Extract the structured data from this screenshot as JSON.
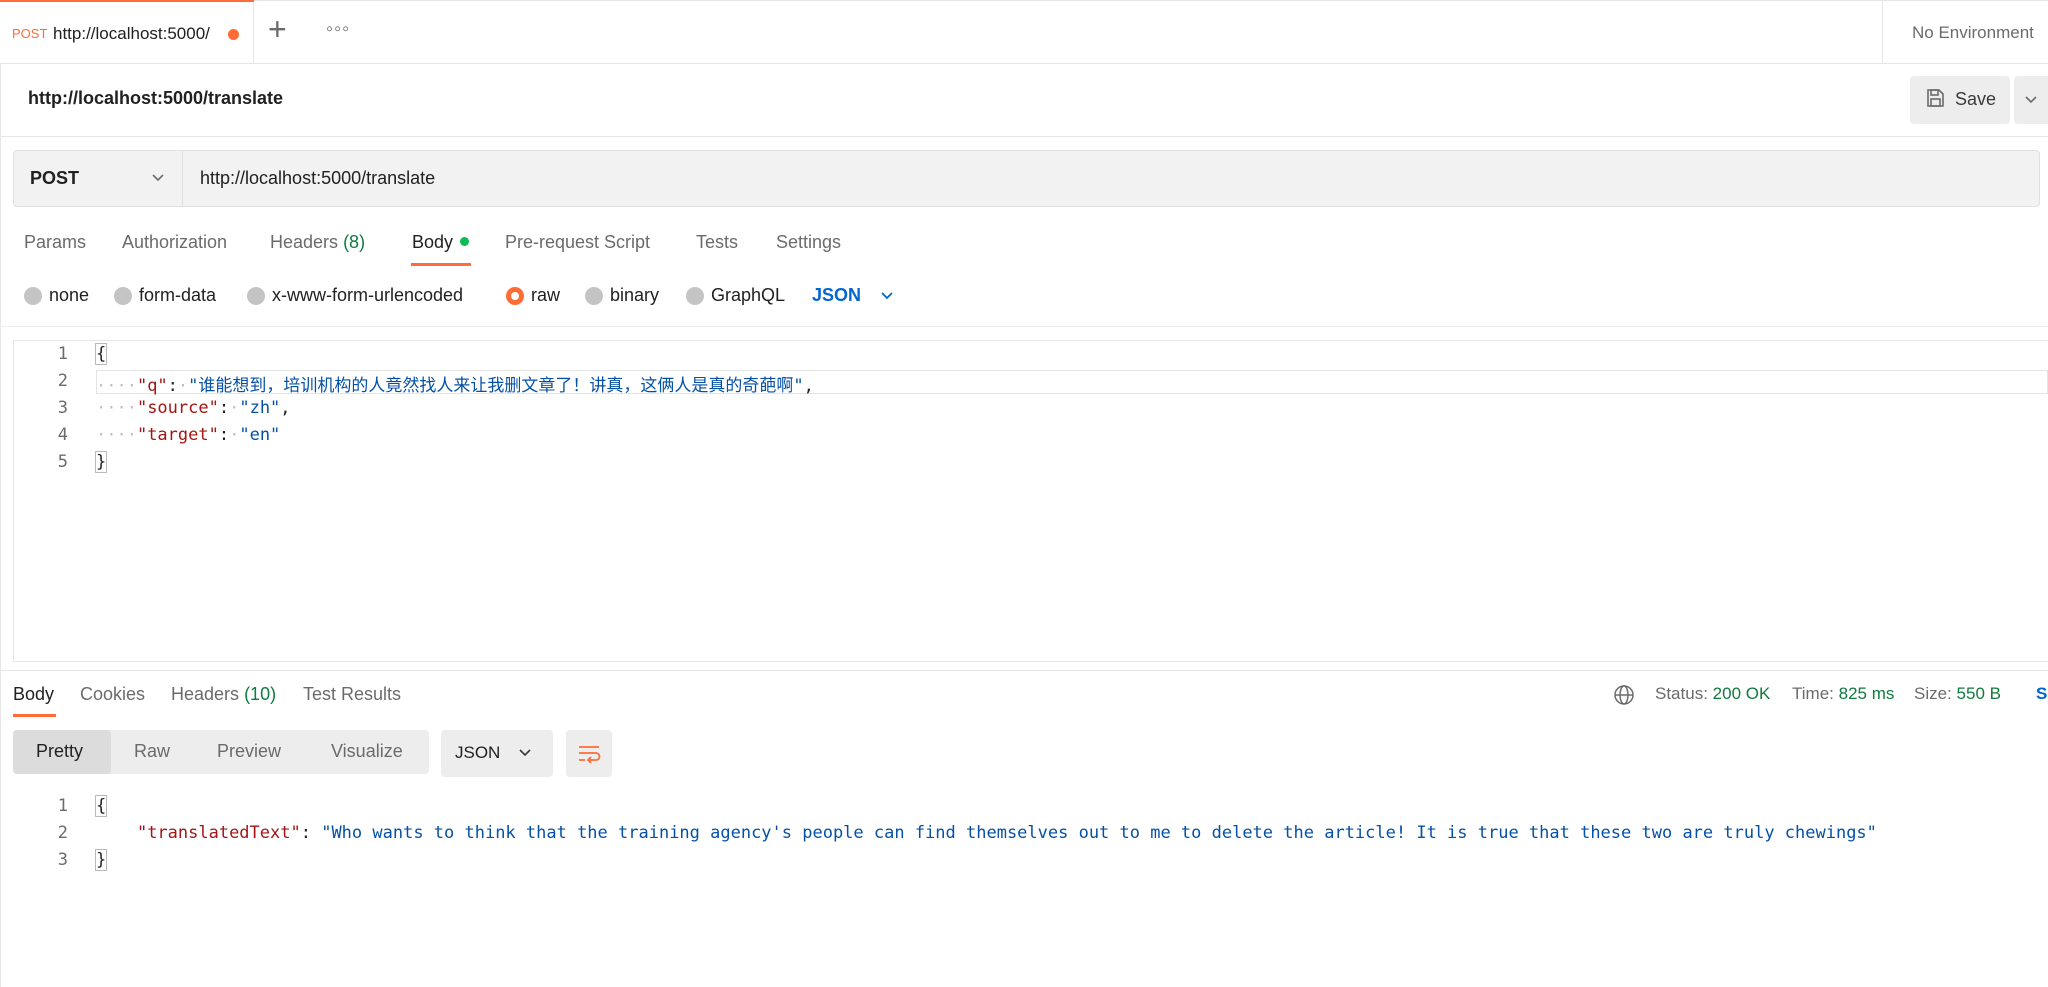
{
  "tabs": [
    {
      "method": "POST",
      "title": "http://localhost:5000/",
      "unsaved": true
    }
  ],
  "environment": "No Environment",
  "request": {
    "title": "http://localhost:5000/translate",
    "save_label": "Save",
    "method": "POST",
    "url": "http://localhost:5000/translate",
    "tabs": {
      "params": "Params",
      "authorization": "Authorization",
      "headers": "Headers",
      "headers_count": "(8)",
      "body": "Body",
      "prerequest": "Pre-request Script",
      "tests": "Tests",
      "settings": "Settings"
    },
    "body_types": {
      "none": "none",
      "form_data": "form-data",
      "urlencoded": "x-www-form-urlencoded",
      "raw": "raw",
      "binary": "binary",
      "graphql": "GraphQL",
      "selected": "raw"
    },
    "language": "JSON",
    "body_lines": {
      "n1": "1",
      "n2": "2",
      "n3": "3",
      "n4": "4",
      "n5": "5",
      "open": "{",
      "q_key": "\"q\"",
      "q_val": "\"谁能想到，培训机构的人竟然找人来让我删文章了！讲真，这俩人是真的奇葩啊\"",
      "source_key": "\"source\"",
      "source_val": "\"zh\"",
      "target_key": "\"target\"",
      "target_val": "\"en\"",
      "close": "}"
    }
  },
  "response": {
    "tabs": {
      "body": "Body",
      "cookies": "Cookies",
      "headers": "Headers",
      "headers_count": "(10)",
      "test_results": "Test Results"
    },
    "status_label": "Status:",
    "status_value": "200 OK",
    "time_label": "Time:",
    "time_value": "825 ms",
    "size_label": "Size:",
    "size_value": "550 B",
    "save_response_fragment": "S",
    "views": {
      "pretty": "Pretty",
      "raw": "Raw",
      "preview": "Preview",
      "visualize": "Visualize"
    },
    "format": "JSON",
    "body_lines": {
      "n1": "1",
      "n2": "2",
      "n3": "3",
      "open": "{",
      "key": "\"translatedText\"",
      "value": "\"Who wants to think that the training agency's people can find themselves out to me to delete the article! It is true that these two are truly chewings\"",
      "close": "}"
    }
  },
  "colors": {
    "accent": "#ff6c37",
    "link": "#0265d2",
    "success": "#0f7b3f"
  }
}
